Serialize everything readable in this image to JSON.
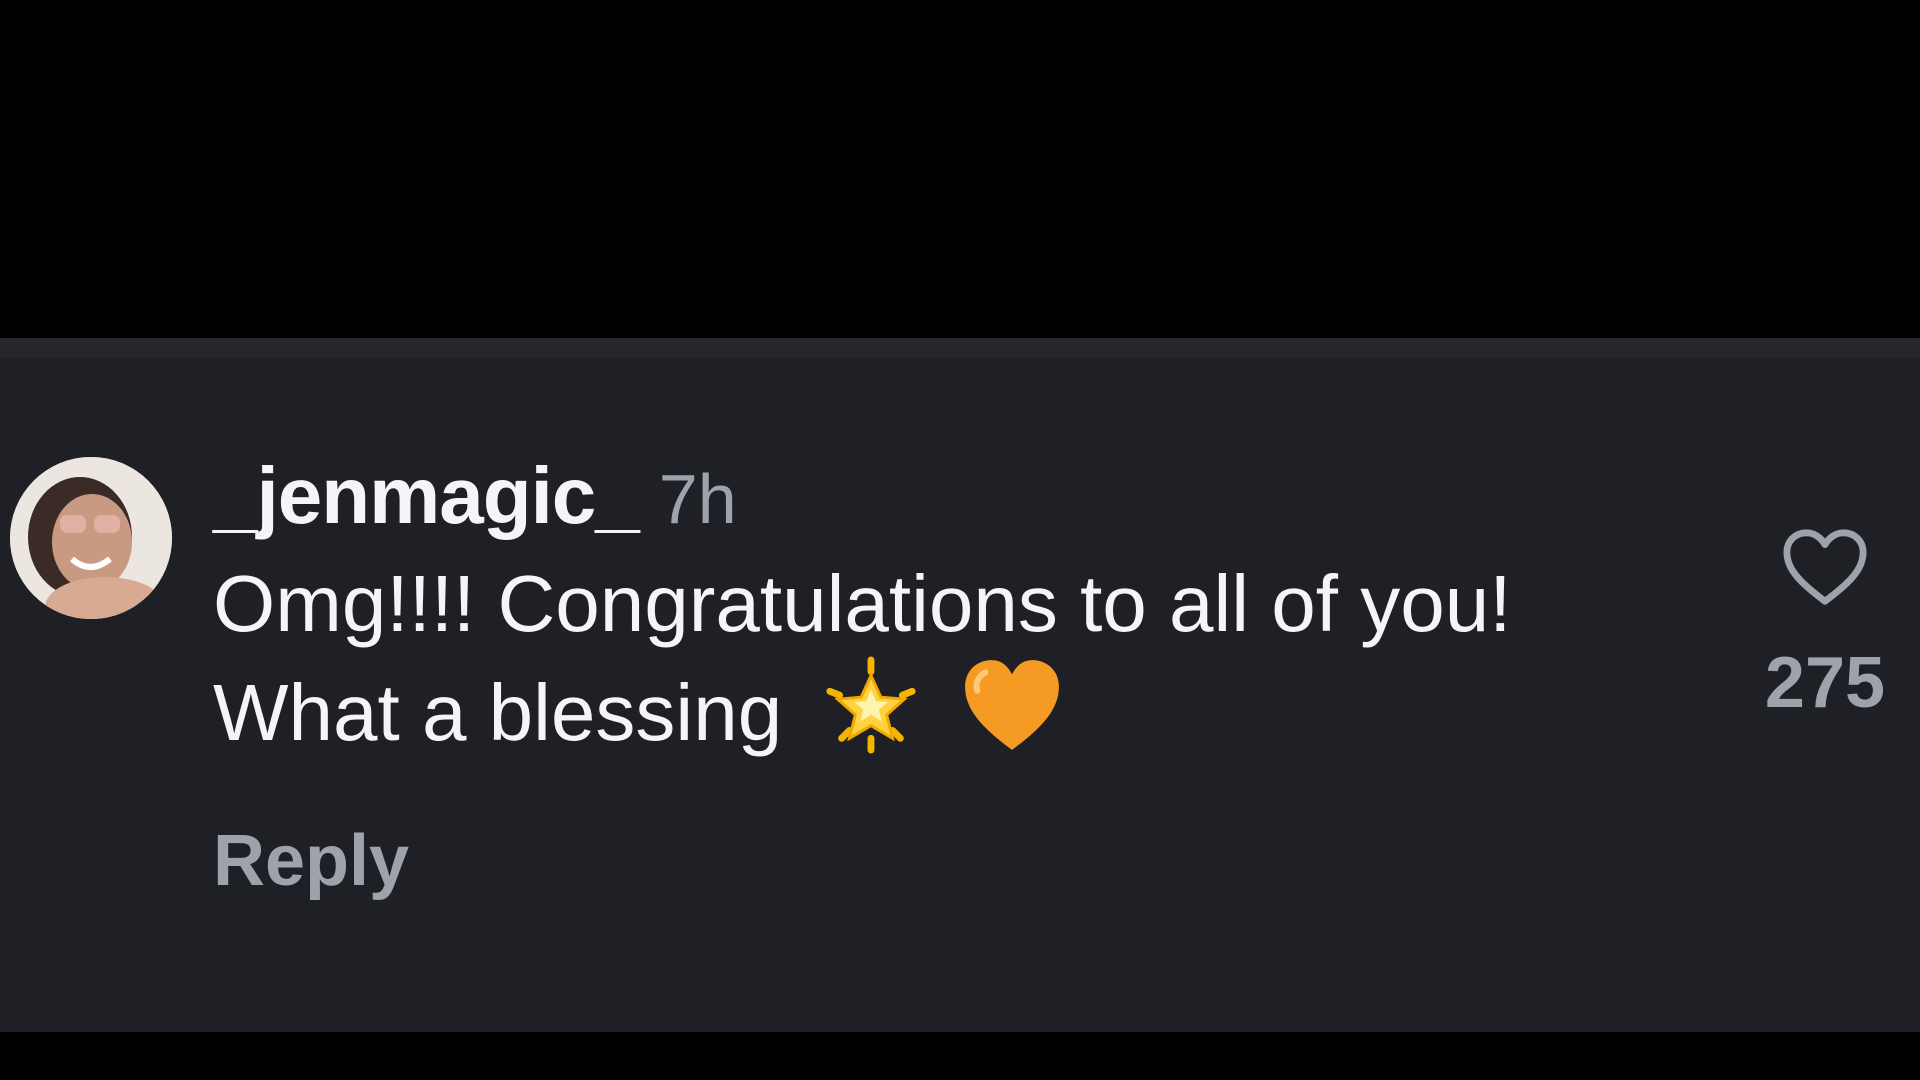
{
  "comment": {
    "username": "_jenmagic_",
    "timestamp": "7h",
    "text": "Omg!!!! Congratulations to all of you! What a blessing",
    "emojis": [
      "glowing-star-icon",
      "orange-heart-icon"
    ],
    "reply_label": "Reply",
    "like_count": "275"
  },
  "colors": {
    "panel_bg": "#1f2026",
    "text_primary": "#f5f5f7",
    "text_secondary": "#9ea2ab"
  }
}
